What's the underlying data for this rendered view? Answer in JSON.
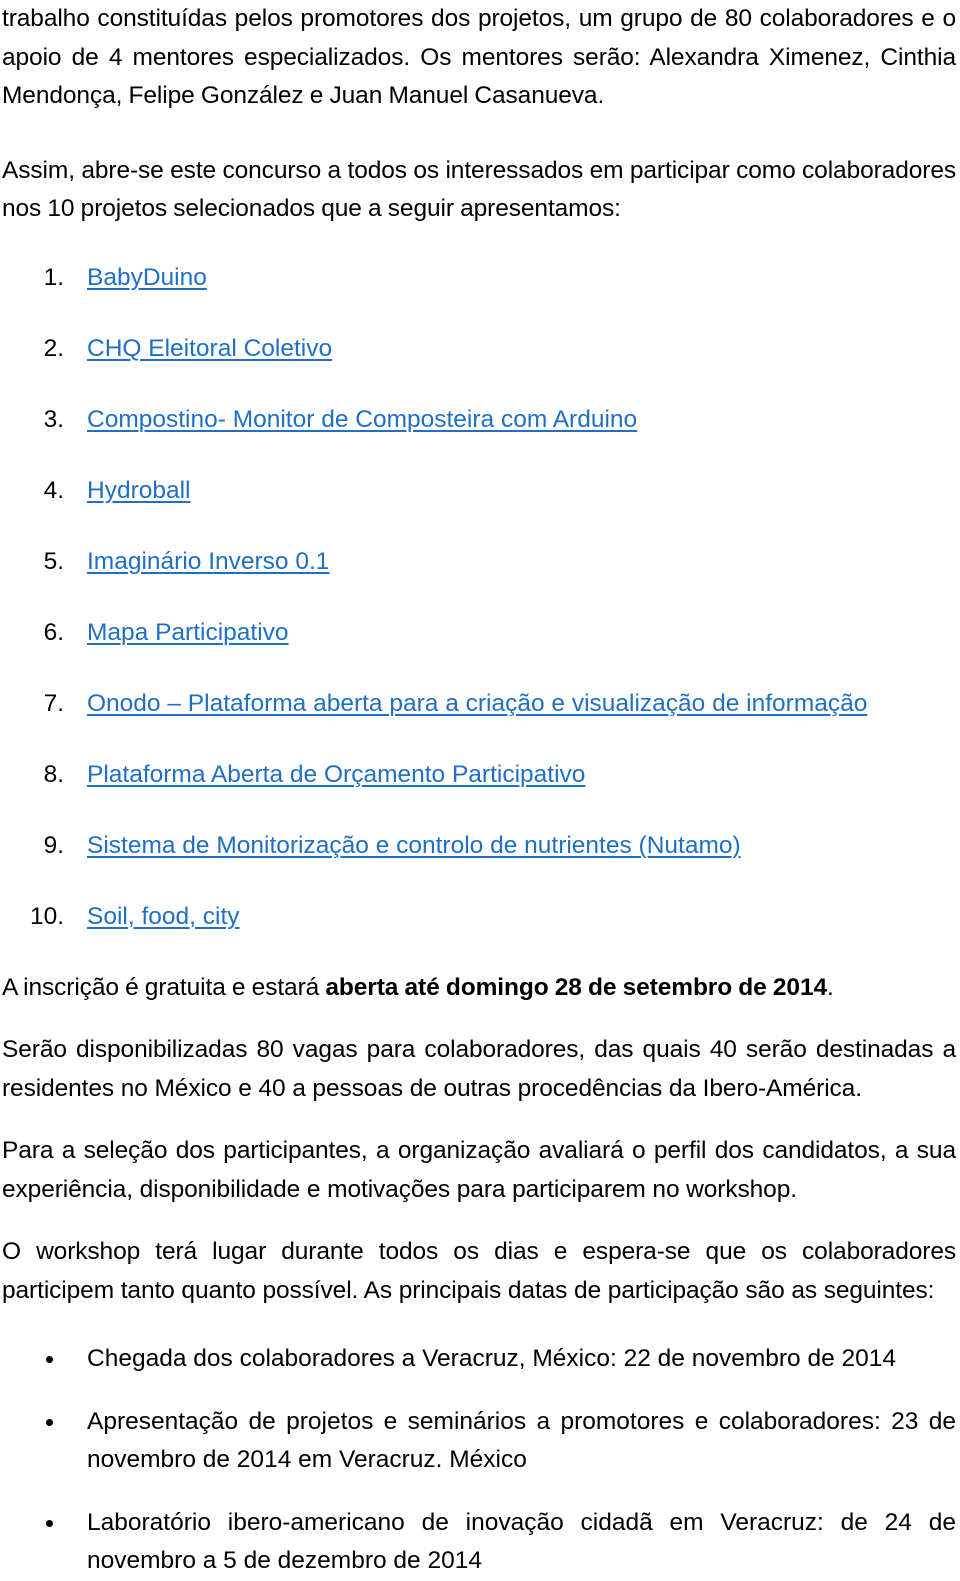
{
  "document": {
    "intro_paragraphs": [
      "trabalho constituídas pelos promotores dos projetos, um grupo de 80 colaboradores e o apoio de 4 mentores especializados. Os mentores serão: Alexandra Ximenez, Cinthia Mendonça, Felipe González e Juan Manuel Casanueva.",
      "Assim, abre-se este concurso a todos os interessados em participar como colaboradores nos 10 projetos selecionados que a seguir apresentamos:"
    ],
    "project_list": {
      "items": [
        {
          "number": "1.",
          "label": "BabyDuino",
          "is_link": true
        },
        {
          "number": "2.",
          "label": "CHQ Eleitoral Coletivo",
          "is_link": true
        },
        {
          "number": "3.",
          "label": "Compostino- Monitor de Composteira com Arduino",
          "is_link": true
        },
        {
          "number": "4.",
          "label": "Hydroball",
          "is_link": true
        },
        {
          "number": "5.",
          "label": "Imaginário Inverso 0.1",
          "is_link": true
        },
        {
          "number": "6.",
          "label": "Mapa Participativo",
          "is_link": true
        },
        {
          "number": "7.",
          "label": "Onodo – Plataforma aberta para a criação e visualização de informação",
          "is_link": true
        },
        {
          "number": "8.",
          "label": "Plataforma Aberta de Orçamento Participativo",
          "is_link": true
        },
        {
          "number": "9.",
          "label": "Sistema de Monitorização e controlo de nutrientes (Nutamo)",
          "is_link": true
        },
        {
          "number": "10.",
          "label": "Soil, food, city",
          "is_link": true
        }
      ]
    },
    "registration": {
      "lead_text": "A inscrição é gratuita e estará ",
      "bold_text": "aberta até domingo 28 de setembro de 2014",
      "trailing_text": "."
    },
    "body_paragraphs": [
      "Serão disponibilizadas 80 vagas para colaboradores, das quais 40 serão destinadas a residentes no México e 40 a pessoas de outras procedências da Ibero-América.",
      "Para a seleção dos participantes, a organização avaliará o perfil dos candidatos, a sua experiência, disponibilidade e motivações para participarem no workshop.",
      "O workshop terá lugar durante todos os dias e espera-se que os colaboradores participem tanto quanto possível. As principais datas de participação são as seguintes:"
    ],
    "dates_list": {
      "items": [
        "Chegada dos colaboradores a Veracruz, México: 22 de novembro de 2014",
        "Apresentação de projetos e seminários a promotores e colaboradores: 23 de novembro de 2014 em Veracruz. México",
        "Laboratório ibero-americano de inovação cidadã em Veracruz: de 24 de novembro a 5 de dezembro de 2014"
      ]
    },
    "colors": {
      "link": "#1F6FC5",
      "text": "#000000",
      "background": "#FFFFFF"
    }
  }
}
